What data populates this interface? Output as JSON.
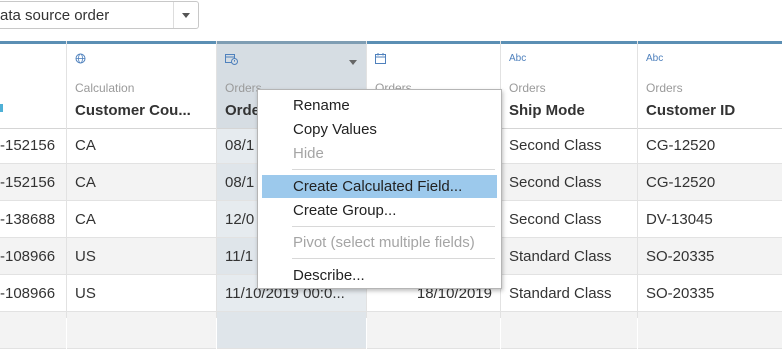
{
  "sort": {
    "value": "ata source order"
  },
  "columns": [
    {
      "source": "",
      "name": "",
      "type_icon": "",
      "cells": [
        "-152156",
        "-152156",
        "-138688",
        "-108966",
        "-108966"
      ]
    },
    {
      "source": "Calculation",
      "name": "Customer Cou...",
      "type_icon": "globe-icon",
      "cells": [
        "CA",
        "CA",
        "CA",
        "US",
        "US"
      ]
    },
    {
      "source": "Orders",
      "name": "Orde",
      "type_icon": "calendar-clock-icon",
      "cells": [
        "08/1",
        "08/1",
        "12/0",
        "11/1",
        "11/10/2019 00:0..."
      ]
    },
    {
      "source": "Orders",
      "name": "",
      "type_icon": "calendar-icon",
      "cells": [
        "",
        "",
        "",
        "",
        "18/10/2019"
      ]
    },
    {
      "source": "Orders",
      "name": "Ship Mode",
      "type_icon": "Abc",
      "cells": [
        "Second Class",
        "Second Class",
        "Second Class",
        "Standard Class",
        "Standard Class"
      ]
    },
    {
      "source": "Orders",
      "name": "Customer ID",
      "type_icon": "Abc",
      "cells": [
        "CG-12520",
        "CG-12520",
        "DV-13045",
        "SO-20335",
        "SO-20335"
      ]
    }
  ],
  "context_menu": {
    "items": [
      {
        "label": "Rename",
        "enabled": true
      },
      {
        "label": "Copy Values",
        "enabled": true
      },
      {
        "label": "Hide",
        "enabled": false
      },
      {
        "label": "Create Calculated Field...",
        "enabled": true,
        "highlighted": true
      },
      {
        "label": "Create Group...",
        "enabled": true
      },
      {
        "label": "Pivot (select multiple fields)",
        "enabled": false
      },
      {
        "label": "Describe...",
        "enabled": true
      }
    ]
  },
  "colors": {
    "accent": "#5b8fb4",
    "menu_highlight": "#9cc9ec",
    "selected_column": "#e6ebef"
  }
}
